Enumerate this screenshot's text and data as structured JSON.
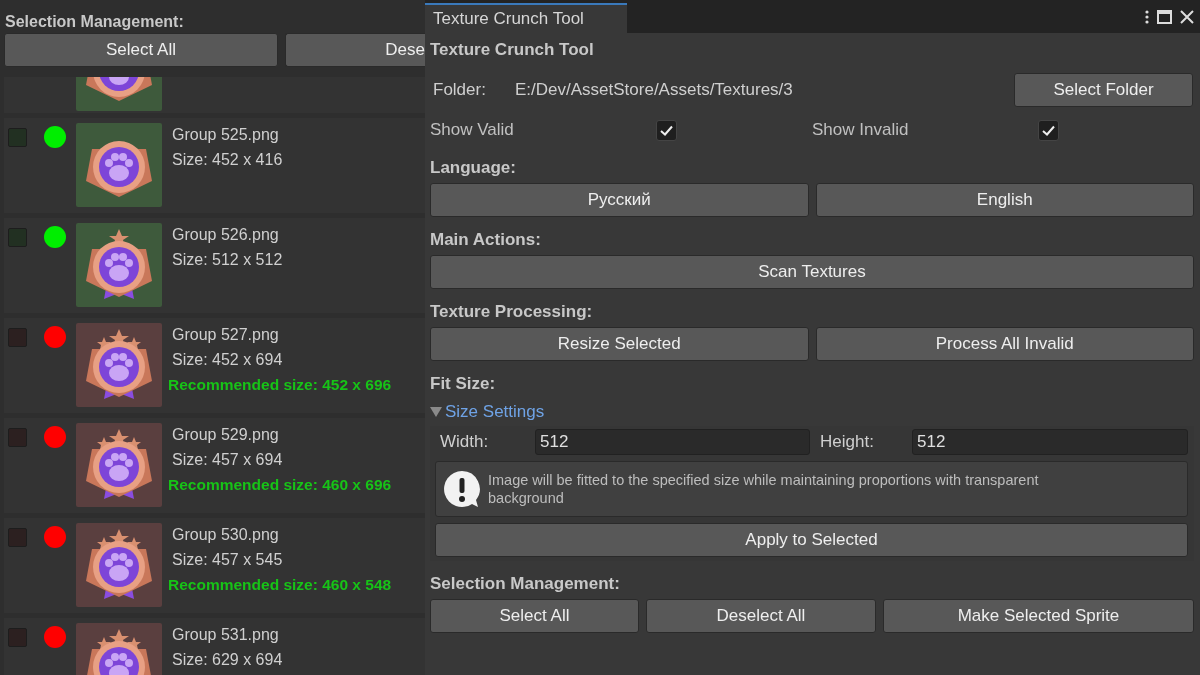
{
  "left_panel": {
    "heading": "Selection Management:",
    "buttons": [
      "Select All",
      "Dese"
    ],
    "textures": [
      {
        "valid": true
      },
      {
        "name": "Group 525.png",
        "size": "Size: 452 x 416",
        "valid": true,
        "checked": false
      },
      {
        "name": "Group 526.png",
        "size": "Size: 512 x 512",
        "valid": true,
        "checked": false
      },
      {
        "name": "Group 527.png",
        "size": "Size: 452 x 694",
        "recommended": "Recommended size: 452 x 696",
        "valid": false,
        "checked": false
      },
      {
        "name": "Group 529.png",
        "size": "Size: 457 x 694",
        "recommended": "Recommended size: 460 x 696",
        "valid": false,
        "checked": false
      },
      {
        "name": "Group 530.png",
        "size": "Size: 457 x 545",
        "recommended": "Recommended size: 460 x 548",
        "valid": false,
        "checked": false
      },
      {
        "name": "Group 531.png",
        "size": "Size: 629 x 694",
        "valid": false,
        "checked": false
      }
    ]
  },
  "window": {
    "tab": "Texture Crunch Tool",
    "title": "Texture Crunch Tool"
  },
  "folder": {
    "label": "Folder:",
    "path": "E:/Dev/AssetStore/Assets/Textures/3",
    "button": "Select Folder"
  },
  "toggles": [
    {
      "label": "Show Valid",
      "checked": true
    },
    {
      "label": "Show Invalid",
      "checked": true
    }
  ],
  "sections": [
    {
      "heading": "Language:",
      "buttons": [
        "Русский",
        "English"
      ]
    },
    {
      "heading": "Main Actions:",
      "buttons": [
        "Scan Textures"
      ]
    },
    {
      "heading": "Texture Processing:",
      "buttons": [
        "Resize Selected",
        "Process All Invalid"
      ]
    },
    {
      "heading": "Fit Size:",
      "foldout": {
        "label": "Size Settings",
        "expanded": true,
        "fields": [
          {
            "label": "Width:",
            "value": "512"
          },
          {
            "label": "Height:",
            "value": "512"
          }
        ],
        "help": "Image will be fitted to the specified size while maintaining proportions with transparent background",
        "button": "Apply to Selected"
      }
    },
    {
      "heading": "Selection Management:",
      "buttons": [
        "Select All",
        "Deselect All",
        "Make Selected Sprite"
      ]
    }
  ]
}
